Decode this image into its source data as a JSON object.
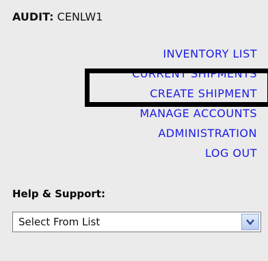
{
  "audit": {
    "label": "AUDIT:",
    "value": "CENLW1"
  },
  "nav": {
    "items": [
      {
        "label": "INVENTORY LIST"
      },
      {
        "label": "CURRENT SHIPMENTS"
      },
      {
        "label": "CREATE SHIPMENT"
      },
      {
        "label": "MANAGE ACCOUNTS"
      },
      {
        "label": "ADMINISTRATION"
      },
      {
        "label": "LOG OUT"
      }
    ]
  },
  "help": {
    "heading": "Help & Support:",
    "select_value": "Select From List"
  },
  "colors": {
    "link": "#1a1ae6",
    "panel_background": "#ebebeb",
    "highlight_box": "#000000"
  },
  "icons": {
    "dropdown": "chevron-down-icon"
  }
}
